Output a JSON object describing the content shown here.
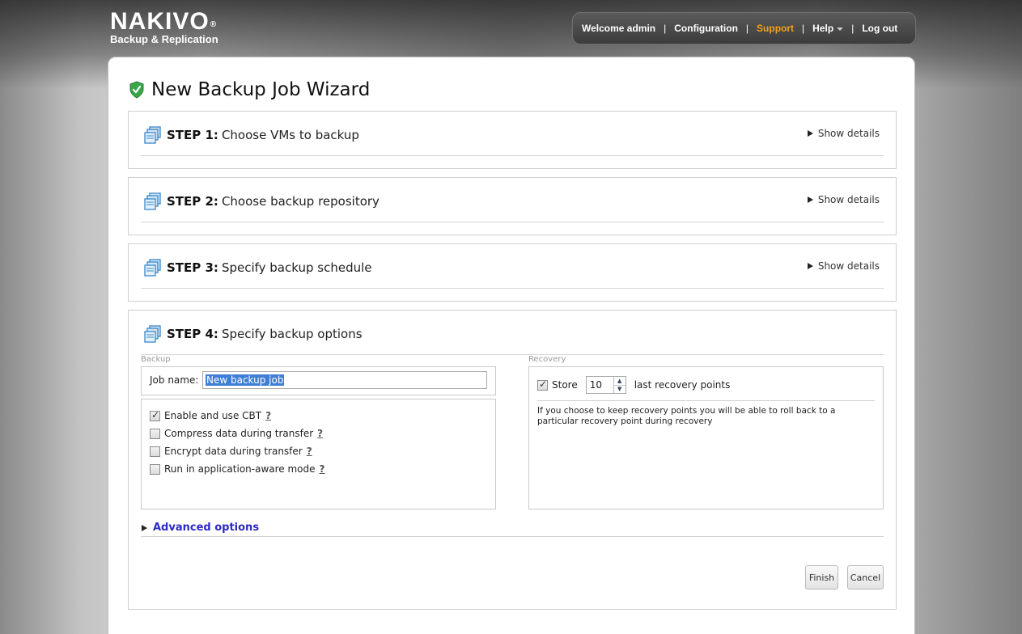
{
  "brand": {
    "name": "NAKIVO",
    "reg": "®",
    "subtitle": "Backup & Replication"
  },
  "nav": {
    "welcome": "Welcome admin",
    "items": [
      {
        "label": "Configuration"
      },
      {
        "label": "Support"
      },
      {
        "label": "Help"
      },
      {
        "label": "Log out"
      }
    ],
    "active_color": "#f5a01a"
  },
  "wizard": {
    "title": "New Backup Job Wizard",
    "show_details": "Show details",
    "steps": [
      {
        "num": "STEP 1:",
        "label": "Choose VMs to backup"
      },
      {
        "num": "STEP 2:",
        "label": "Choose backup repository"
      },
      {
        "num": "STEP 3:",
        "label": "Specify backup schedule"
      },
      {
        "num": "STEP 4:",
        "label": "Specify backup options"
      }
    ]
  },
  "backup": {
    "legend": "Backup",
    "job_name_label": "Job name:",
    "job_name_value": "New backup job",
    "help_mark": "?",
    "options": [
      {
        "label": "Enable and use CBT",
        "checked": true
      },
      {
        "label": "Compress data during transfer",
        "checked": false
      },
      {
        "label": "Encrypt data during transfer",
        "checked": false
      },
      {
        "label": "Run in application-aware mode",
        "checked": false
      }
    ]
  },
  "recovery": {
    "legend": "Recovery",
    "store_label": "Store",
    "store_checked": true,
    "store_value": "10",
    "points_label": "last recovery points",
    "note": "If you choose to keep recovery points you will be able to roll back to a particular recovery point during recovery"
  },
  "advanced": {
    "label": "Advanced options"
  },
  "buttons": {
    "finish": "Finish",
    "cancel": "Cancel"
  }
}
